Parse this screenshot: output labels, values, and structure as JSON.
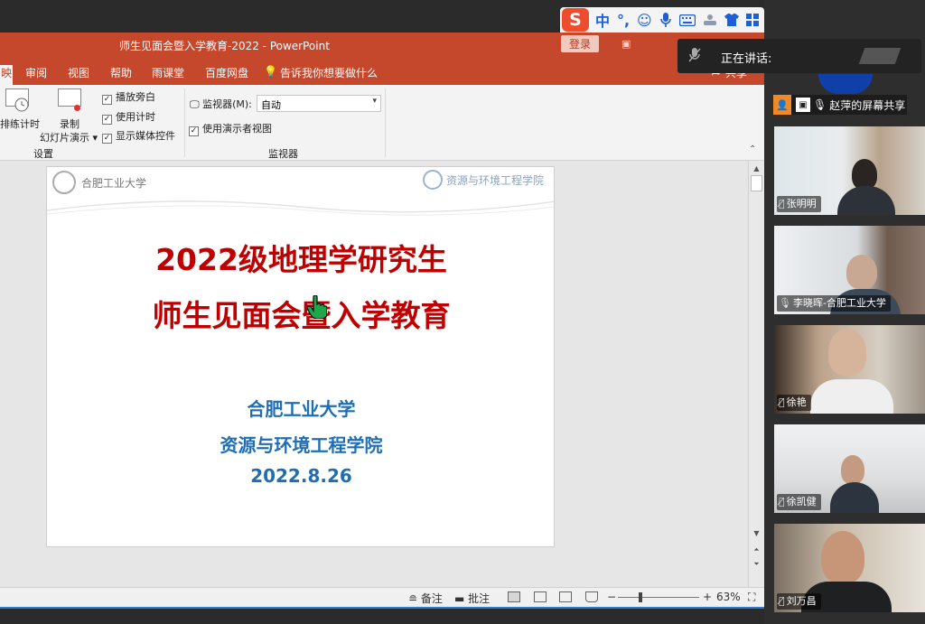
{
  "ime": {
    "logo": "S",
    "lang": "中",
    "punct": "°,",
    "emoji": "☺",
    "mic": "🎙",
    "keyboard": "⌨",
    "icons": [
      "soft-keyboard-icon",
      "skin-icon",
      "grid-icon"
    ]
  },
  "window": {
    "title": "师生见面会暨入学教育-2022  -  PowerPoint",
    "login": "登录",
    "share": "共享"
  },
  "tabs": [
    "审阅",
    "视图",
    "帮助",
    "雨课堂",
    "百度网盘",
    "告诉我你想要做什么"
  ],
  "ribbon": {
    "rehearse": "排练计时",
    "record_top": "录制",
    "record_bottom": "幻灯片演示",
    "play_narration": "播放旁白",
    "use_timing": "使用计时",
    "show_media": "显示媒体控件",
    "group_setup": "设置",
    "monitor_label": "监视器(M):",
    "monitor_value": "自动",
    "presenter_view": "使用演示者视图",
    "group_monitor": "监视器"
  },
  "slide": {
    "logo_left": "合肥工业大学",
    "logo_right": "资源与环境工程学院",
    "title_line1": "2022级地理学研究生",
    "title_line2": "师生见面会暨入学教育",
    "org1": "合肥工业大学",
    "org2": "资源与环境工程学院",
    "date": "2022.8.26"
  },
  "status": {
    "notes": "备注",
    "comments": "批注",
    "zoom": "63%",
    "zoom_minus": "−",
    "zoom_plus": "+"
  },
  "meeting": {
    "speaking_label": "正在讲话:",
    "screen_share": "赵萍的屏幕共享",
    "participants": [
      {
        "name": "张明明",
        "muted": true
      },
      {
        "name": "李晓晖-合肥工业大学",
        "muted": false
      },
      {
        "name": "徐艳",
        "muted": true
      },
      {
        "name": "徐凯健",
        "muted": true
      },
      {
        "name": "刘万昌",
        "muted": true
      }
    ]
  },
  "colors": {
    "ppt_orange": "#c5482c",
    "slide_red": "#c00000",
    "slide_blue": "#1f6db3",
    "share_orange": "#f08a24"
  }
}
